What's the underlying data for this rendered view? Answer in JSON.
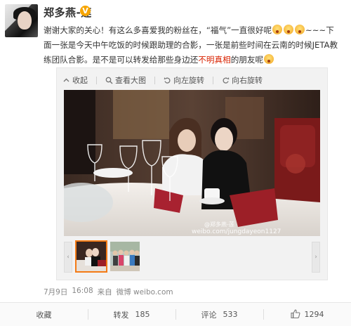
{
  "user": {
    "name": "郑多燕-莲",
    "badge": "V"
  },
  "post": {
    "line1_a": "谢谢大家的关心！有这么多喜爱我的粉丝在，“福气”一直很好呢",
    "line1_b": "~~~下",
    "line2": "面一张是今天中午吃饭的时候跟助理的合影，一张是前些时间在云南的时候JETA教",
    "line3_a": "练团队合影。是不是可以转发给那些身边还",
    "line3_highlight": "不明真相",
    "line3_b": "的朋友呢"
  },
  "media": {
    "toolbar": {
      "collapse": "收起",
      "view_large": "查看大图",
      "rotate_left": "向左旋转",
      "rotate_right": "向右旋转"
    },
    "photo_watermark_a": "@郑多燕-莲",
    "photo_watermark_b": "weibo.com/jungdayeon1127"
  },
  "meta": {
    "date": "7月9日",
    "time": "16:08",
    "from_prefix": "来自",
    "source": "微博 weibo.com"
  },
  "actions": {
    "favorite": "收藏",
    "repost": "转发",
    "repost_count": "185",
    "comment": "评论",
    "comment_count": "533",
    "like_count": "1294"
  },
  "colors": {
    "highlight": "#d92200",
    "badge": "#f7a500",
    "thumb_active": "#f47b16"
  }
}
